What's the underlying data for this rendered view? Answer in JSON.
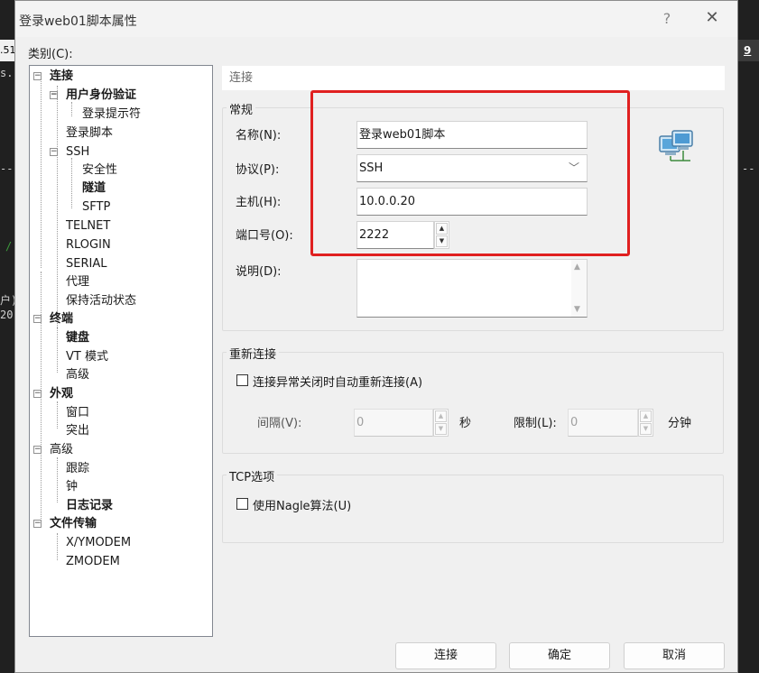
{
  "background": {
    "left_tab_text": ".51",
    "right_tab_text": "9",
    "fragments": [
      "s.",
      "--",
      "/",
      "户)",
      "20",
      "--"
    ]
  },
  "dialog": {
    "title": "登录web01脚本属性",
    "help_glyph": "?",
    "close_glyph": "✕"
  },
  "category_label": "类别(C):",
  "tree": [
    {
      "label": "连接",
      "bold": true,
      "toggle": "−"
    },
    {
      "label": "用户身份验证",
      "bold": true,
      "toggle": "−"
    },
    {
      "label": "登录提示符",
      "bold": false
    },
    {
      "label": "登录脚本",
      "bold": false
    },
    {
      "label": "SSH",
      "bold": false,
      "toggle": "−"
    },
    {
      "label": "安全性",
      "bold": false
    },
    {
      "label": "隧道",
      "bold": true
    },
    {
      "label": "SFTP",
      "bold": false
    },
    {
      "label": "TELNET",
      "bold": false
    },
    {
      "label": "RLOGIN",
      "bold": false
    },
    {
      "label": "SERIAL",
      "bold": false
    },
    {
      "label": "代理",
      "bold": false
    },
    {
      "label": "保持活动状态",
      "bold": false
    },
    {
      "label": "终端",
      "bold": true,
      "toggle": "−"
    },
    {
      "label": "键盘",
      "bold": true
    },
    {
      "label": "VT 模式",
      "bold": false
    },
    {
      "label": "高级",
      "bold": false
    },
    {
      "label": "外观",
      "bold": true,
      "toggle": "−"
    },
    {
      "label": "窗口",
      "bold": false
    },
    {
      "label": "突出",
      "bold": false
    },
    {
      "label": "高级",
      "bold": false,
      "toggle": "−"
    },
    {
      "label": "跟踪",
      "bold": false
    },
    {
      "label": "钟",
      "bold": false
    },
    {
      "label": "日志记录",
      "bold": true
    },
    {
      "label": "文件传输",
      "bold": true,
      "toggle": "−"
    },
    {
      "label": "X/YMODEM",
      "bold": false
    },
    {
      "label": "ZMODEM",
      "bold": false
    }
  ],
  "panel": {
    "header": "连接",
    "general": {
      "title": "常规",
      "name_label": "名称(N):",
      "name_value": "登录web01脚本",
      "protocol_label": "协议(P):",
      "protocol_value": "SSH",
      "host_label": "主机(H):",
      "host_value": "10.0.0.20",
      "port_label": "端口号(O):",
      "port_value": "2222",
      "desc_label": "说明(D):",
      "desc_value": ""
    },
    "reconnect": {
      "title": "重新连接",
      "auto_label": "连接异常关闭时自动重新连接(A)",
      "auto_checked": false,
      "interval_label": "间隔(V):",
      "interval_value": "0",
      "interval_unit": "秒",
      "limit_label": "限制(L):",
      "limit_value": "0",
      "limit_unit": "分钟"
    },
    "tcp": {
      "title": "TCP选项",
      "nagle_label": "使用Nagle算法(U)",
      "nagle_checked": false
    }
  },
  "buttons": {
    "connect": "连接",
    "ok": "确定",
    "cancel": "取消"
  },
  "colors": {
    "highlight": "#e02020",
    "dialog_bg": "#f0f0f0"
  }
}
